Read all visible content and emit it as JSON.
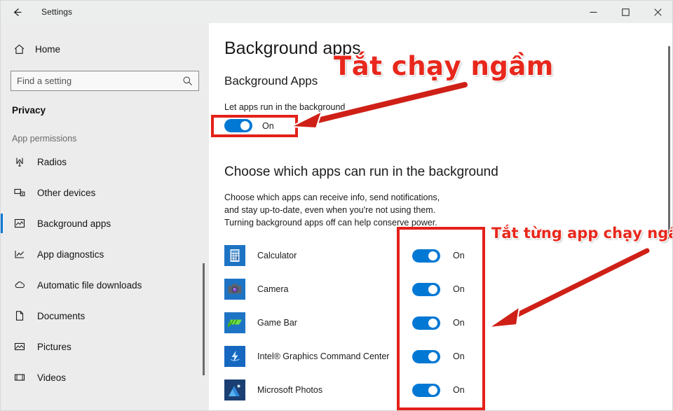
{
  "titlebar": {
    "back_icon": "arrow-left-icon",
    "title": "Settings",
    "minimize_label": "–",
    "maximize_label": "□",
    "close_label": "✕"
  },
  "sidebar": {
    "home": {
      "label": "Home",
      "icon": "home-icon"
    },
    "search": {
      "placeholder": "Find a setting",
      "value": "",
      "icon": "search-icon"
    },
    "category": "Privacy",
    "group_header": "App permissions",
    "items": [
      {
        "label": "Radios",
        "icon": "radio-tower-icon",
        "selected": false
      },
      {
        "label": "Other devices",
        "icon": "devices-icon",
        "selected": false
      },
      {
        "label": "Background apps",
        "icon": "background-apps-icon",
        "selected": true
      },
      {
        "label": "App diagnostics",
        "icon": "app-diagnostics-icon",
        "selected": false
      },
      {
        "label": "Automatic file downloads",
        "icon": "cloud-icon",
        "selected": false
      },
      {
        "label": "Documents",
        "icon": "document-icon",
        "selected": false
      },
      {
        "label": "Pictures",
        "icon": "picture-icon",
        "selected": false
      },
      {
        "label": "Videos",
        "icon": "video-icon",
        "selected": false
      }
    ]
  },
  "main": {
    "page_title": "Background apps",
    "section_title": "Background Apps",
    "master_toggle": {
      "label": "Let apps run in the background",
      "state_text": "On",
      "state": true
    },
    "choose_heading": "Choose which apps can run in the background",
    "choose_description": "Choose which apps can receive info, send notifications, and stay up-to-date, even when you're not using them. Turning background apps off can help conserve power.",
    "apps": [
      {
        "name": "Calculator",
        "icon": "calculator-app-icon",
        "state_text": "On",
        "state": true
      },
      {
        "name": "Camera",
        "icon": "camera-app-icon",
        "state_text": "On",
        "state": true
      },
      {
        "name": "Game Bar",
        "icon": "game-bar-app-icon",
        "state_text": "On",
        "state": true
      },
      {
        "name": "Intel® Graphics Command Center",
        "icon": "intel-graphics-app-icon",
        "state_text": "On",
        "state": true
      },
      {
        "name": "Microsoft Photos",
        "icon": "microsoft-photos-app-icon",
        "state_text": "On",
        "state": true
      }
    ]
  },
  "annotations": {
    "text_1": "Tắt chạy ngầm",
    "text_2": "Tắt từng app chạy ngầm",
    "color": "#e8271c"
  },
  "colors": {
    "accent": "#0078d4",
    "sidebar_bg": "#ececed",
    "titlebar_bg": "#eceded",
    "annotation_red": "#e32119"
  }
}
